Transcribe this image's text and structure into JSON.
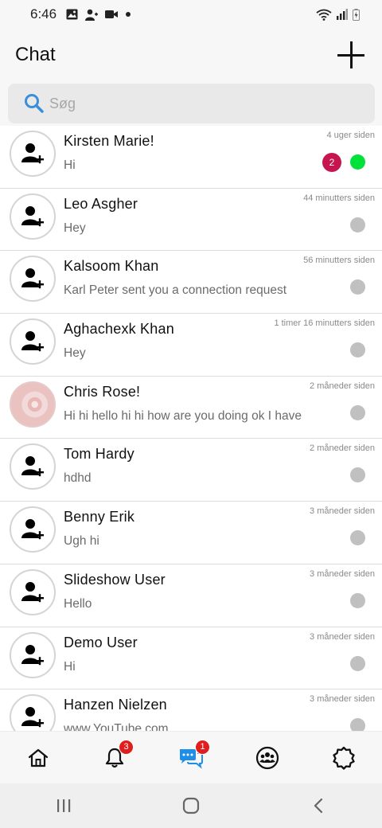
{
  "status_bar": {
    "time": "6:46",
    "icons_left": [
      "image-icon",
      "contact-icon",
      "video-icon",
      "dot-icon"
    ],
    "icons_right": [
      "wifi-icon",
      "signal-icon",
      "battery-charging-icon"
    ]
  },
  "header": {
    "title": "Chat",
    "add_icon": "plus-icon"
  },
  "search": {
    "placeholder": "Søg",
    "icon": "search-icon"
  },
  "colors": {
    "online": "#00e23a",
    "offline": "#c0c0c0",
    "unread_badge": "#c6164f",
    "nav_badge": "#e01e1e",
    "active_nav": "#1f8ee6",
    "search_icon": "#3b8fd9"
  },
  "chats": [
    {
      "name": "Kirsten Marie!",
      "preview": "Hi",
      "time": "4 uger siden",
      "unread": "2",
      "status": "online",
      "avatar": "add-user-icon"
    },
    {
      "name": "Leo Asgher",
      "preview": "Hey",
      "time": "44 minutters siden",
      "status": "offline",
      "avatar": "add-user-icon"
    },
    {
      "name": "Kalsoom Khan",
      "preview": "Karl Peter sent you a connection request",
      "time": "56 minutters siden",
      "status": "offline",
      "avatar": "add-user-icon"
    },
    {
      "name": "Aghachexk Khan",
      "preview": "Hey",
      "time": "1 timer 16 minutters siden",
      "status": "offline",
      "avatar": "add-user-icon"
    },
    {
      "name": "Chris Rose!",
      "preview": "Hi hi hello hi hi how are you doing ok I have",
      "time": "2 måneder siden",
      "status": "offline",
      "avatar": "photo"
    },
    {
      "name": "Tom Hardy",
      "preview": "hdhd",
      "time": "2 måneder siden",
      "status": "offline",
      "avatar": "add-user-icon"
    },
    {
      "name": "Benny Erik",
      "preview": "Ugh hi",
      "time": "3 måneder siden",
      "status": "offline",
      "avatar": "add-user-icon"
    },
    {
      "name": "Slideshow User",
      "preview": "Hello",
      "time": "3 måneder siden",
      "status": "offline",
      "avatar": "add-user-icon"
    },
    {
      "name": "Demo User",
      "preview": "Hi",
      "time": "3 måneder siden",
      "status": "offline",
      "avatar": "add-user-icon"
    },
    {
      "name": "Hanzen Nielzen",
      "preview": "www.YouTube.com",
      "time": "3 måneder siden",
      "status": "offline",
      "avatar": "add-user-icon"
    }
  ],
  "bottom_nav": {
    "items": [
      {
        "icon": "home-icon",
        "badge": null
      },
      {
        "icon": "bell-icon",
        "badge": "3"
      },
      {
        "icon": "chat-icon",
        "badge": "1",
        "active": true
      },
      {
        "icon": "group-icon",
        "badge": null
      },
      {
        "icon": "settings-icon",
        "badge": null
      }
    ]
  },
  "system_nav": {
    "items": [
      "recents-icon",
      "home-circle-icon",
      "back-icon"
    ]
  }
}
